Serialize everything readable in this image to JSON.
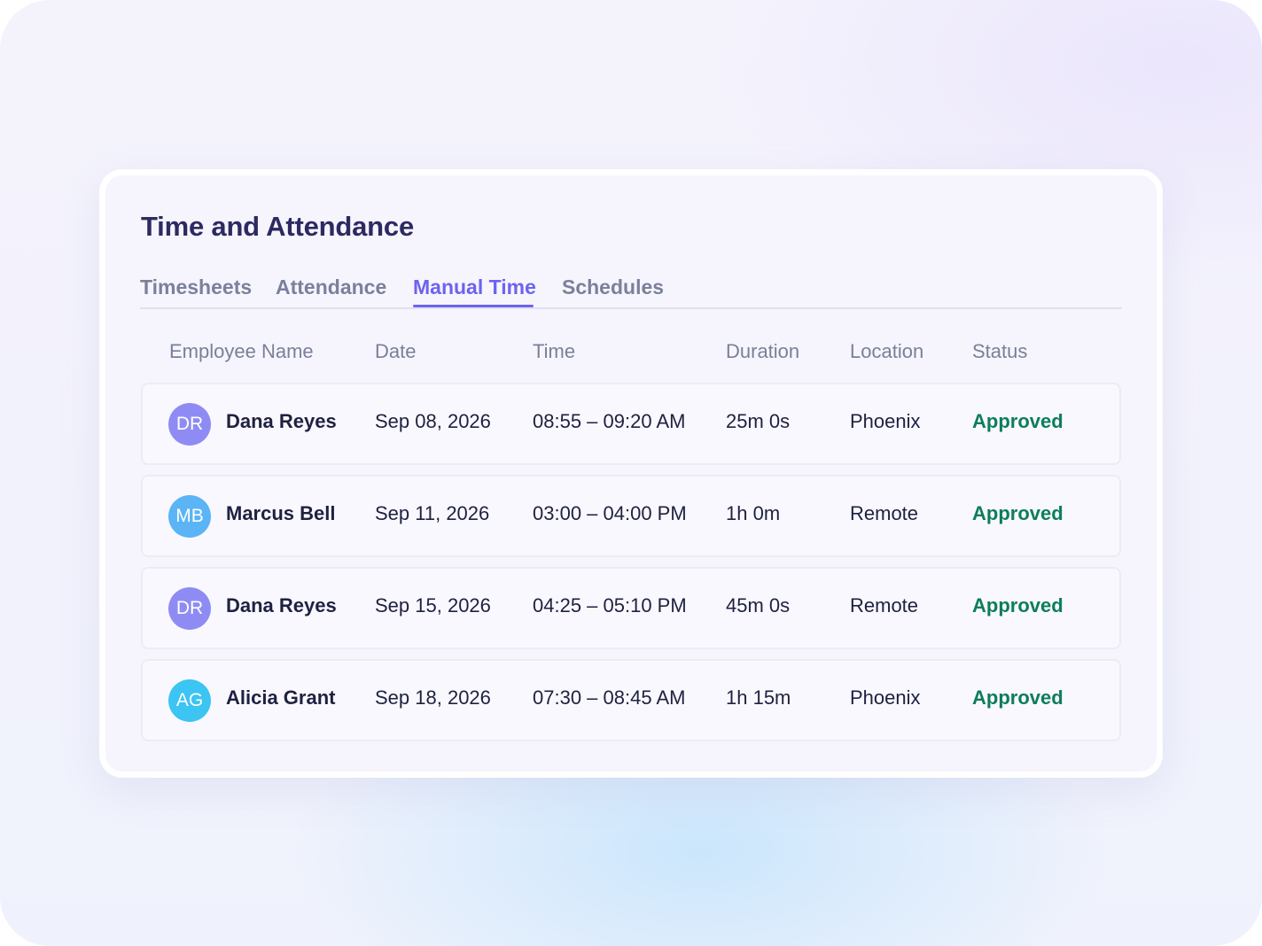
{
  "title": "Time and Attendance",
  "tabs": [
    {
      "label": "Timesheets",
      "active": false
    },
    {
      "label": "Attendance",
      "active": false
    },
    {
      "label": "Manual Time",
      "active": true
    },
    {
      "label": "Schedules",
      "active": false
    }
  ],
  "columns": [
    "Employee Name",
    "Date",
    "Time",
    "Duration",
    "Location",
    "Status"
  ],
  "rows": [
    {
      "initials": "DR",
      "avatar_color": "#8e8cf4",
      "name": "Dana Reyes",
      "date": "Sep 08, 2026",
      "time": "08:55 – 09:20 AM",
      "duration": "25m 0s",
      "location": "Phoenix",
      "status": "Approved"
    },
    {
      "initials": "MB",
      "avatar_color": "#5ab4f6",
      "name": "Marcus Bell",
      "date": "Sep 11, 2026",
      "time": "03:00 – 04:00 PM",
      "duration": "1h 0m",
      "location": "Remote",
      "status": "Approved"
    },
    {
      "initials": "DR",
      "avatar_color": "#8e8cf4",
      "name": "Dana Reyes",
      "date": "Sep 15, 2026",
      "time": "04:25 – 05:10 PM",
      "duration": "45m 0s",
      "location": "Remote",
      "status": "Approved"
    },
    {
      "initials": "AG",
      "avatar_color": "#3cc4f2",
      "name": "Alicia Grant",
      "date": "Sep 18, 2026",
      "time": "07:30 – 08:45 AM",
      "duration": "1h 15m",
      "location": "Phoenix",
      "status": "Approved"
    }
  ],
  "colors": {
    "accent": "#6d63ef",
    "status_approved": "#0d7d5a",
    "title": "#2c2a61"
  }
}
